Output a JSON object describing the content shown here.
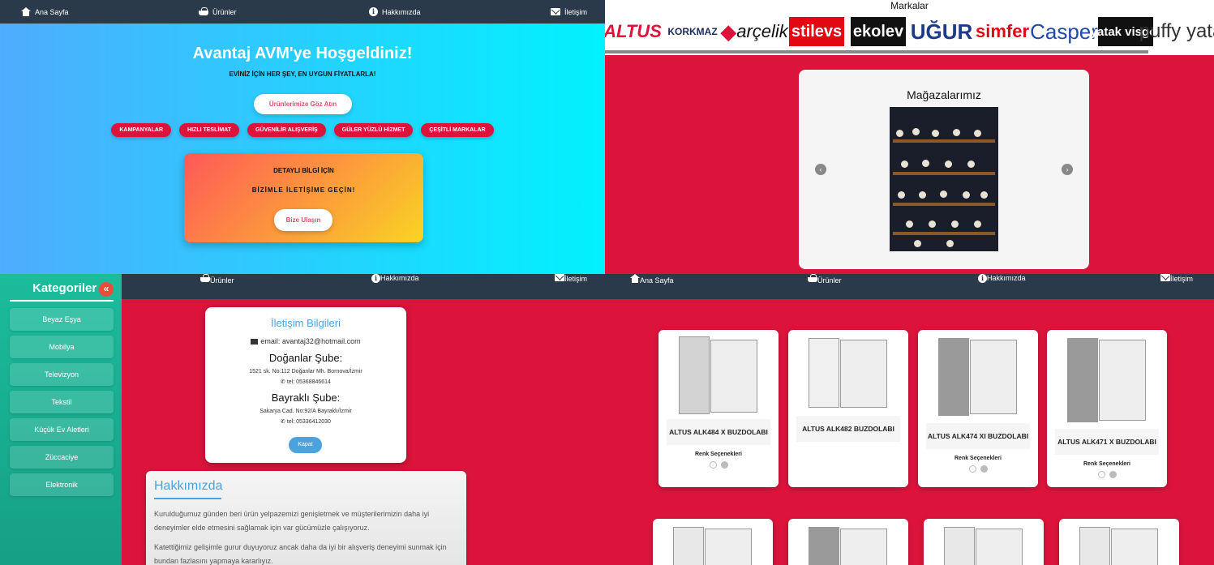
{
  "nav": {
    "home": "Ana Sayfa",
    "products": "Ürünler",
    "about": "Hakkımızda",
    "contact": "İletişim"
  },
  "hero": {
    "title": "Avantaj AVM'ye Hoşgeldiniz!",
    "subtitle": "EVİNİZ İÇİN HER ŞEY, EN UYGUN FİYATLARLA!",
    "cta_button": "Ürünlerimize Göz Atın",
    "badges": [
      "KAMPANYALAR",
      "HIZLI TESLİMAT",
      "GÜVENİLİR ALIŞVERİŞ",
      "GÜLER YÜZLÜ HİZMET",
      "ÇEŞİTLİ MARKALAR"
    ],
    "contact_box": {
      "line1": "DETAYLI BİLGİ İÇİN",
      "line2": "BİZİMLE İLETİŞİME GEÇİN!",
      "button": "Bize Ulaşın"
    }
  },
  "brands": {
    "title": "Markalar",
    "logos": [
      "ALTUS",
      "KORKMAZ",
      "arçelik",
      "stilevs",
      "ekolev",
      "UĞUR",
      "simfer",
      "Casper",
      "yatak visgo!",
      "puffy yatak"
    ],
    "colors": {
      "altus": "#dc143c",
      "korkmaz": "#1a2a5a",
      "arcelik": "#dc143c",
      "stilevs": "#e30613",
      "ekolev": "#111111",
      "ugur": "#1d3b8b",
      "simfer": "#e30613",
      "casper": "#1e4aa8",
      "visgo": "#111111",
      "puffy": "#333333"
    }
  },
  "stores": {
    "title": "Mağazalarımız",
    "prev": "‹",
    "next": "›"
  },
  "categories": {
    "title": "Kategoriler",
    "collapse": "«",
    "items": [
      "Beyaz Eşya",
      "Mobilya",
      "Televizyon",
      "Tekstil",
      "Küçük Ev Aletleri",
      "Züccaciye",
      "Elektronik"
    ]
  },
  "contact_modal": {
    "title": "İletişim Bilgileri",
    "email": "email: avantaj32@hotmail.com",
    "branch1": {
      "name": "Doğanlar Şube:",
      "address": "1521 sk. No:112 Doğanlar Mh. Bornova/İzmir",
      "tel": "tel: 05368846614"
    },
    "branch2": {
      "name": "Bayraklı Şube:",
      "address": "Sakarya Cad. No:92/A Bayraklı/İzmir",
      "tel": "tel: 05336412030"
    },
    "close": "Kapat"
  },
  "about": {
    "title": "Hakkımızda",
    "p1": "Kurulduğumuz günden beri ürün yelpazemizi genişletmek ve müşterilerimizin daha iyi deneyimler elde etmesini sağlamak için var gücümüzle çalışıyoruz.",
    "p2": "Katettiğimiz gelişimle gurur duyuyoruz ancak daha da iyi bir alışveriş deneyimi sunmak için bundan fazlasını yapmaya kararlıyız."
  },
  "products": {
    "color_options_label": "Renk Seçenekleri",
    "items": [
      {
        "name": "ALTUS ALK484 X BUZDOLABI",
        "has_colors": true
      },
      {
        "name": "ALTUS ALK482 BUZDOLABI",
        "has_colors": false
      },
      {
        "name": "ALTUS ALK474 XI BUZDOLABI",
        "has_colors": true
      },
      {
        "name": "ALTUS ALK471 X BUZDOLABI",
        "has_colors": true
      }
    ]
  },
  "theme": {
    "crimson": "#dc143c",
    "navy": "#2b3a4b",
    "teal": "#1abc9c",
    "blue_accent": "#4aa3df"
  }
}
